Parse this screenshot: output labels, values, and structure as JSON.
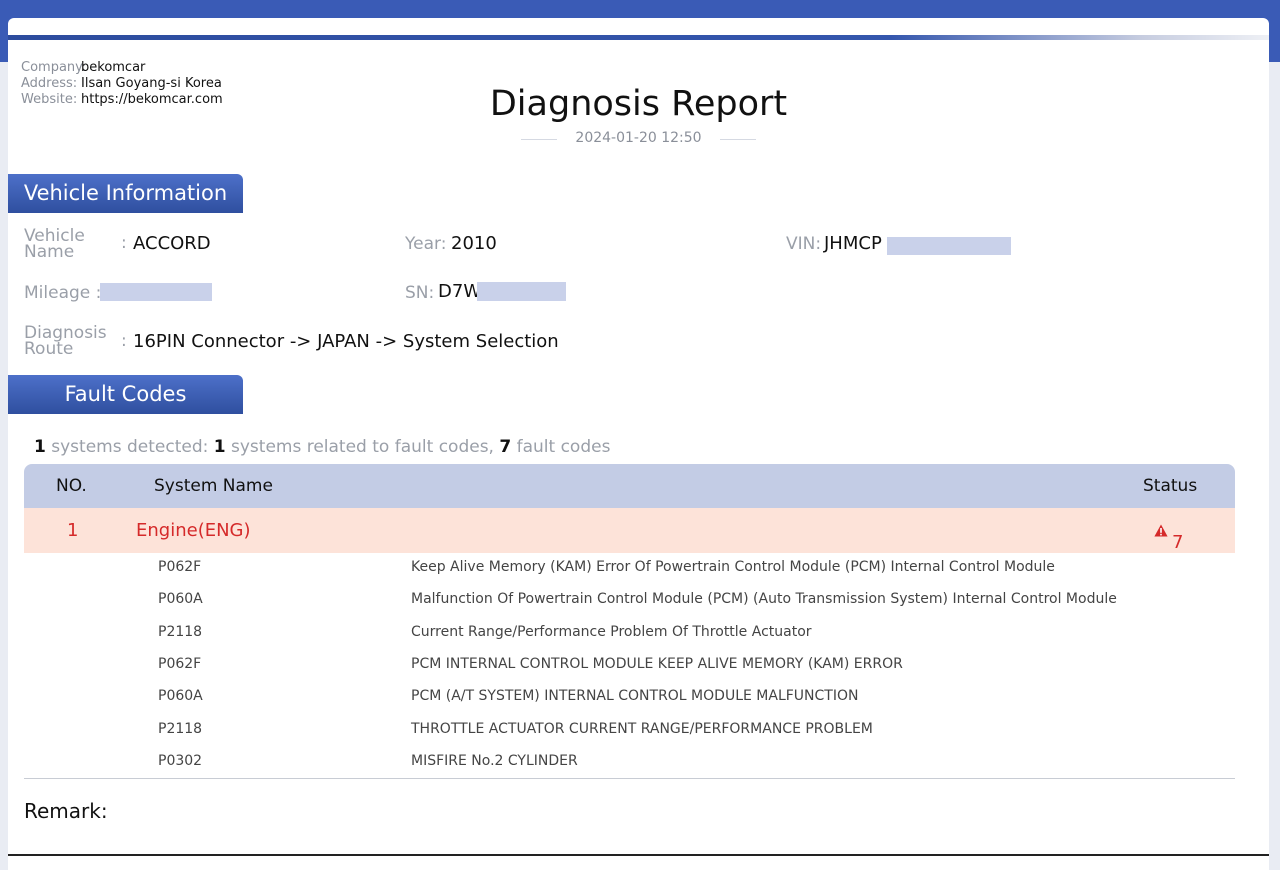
{
  "header": {
    "company_label": "Company:",
    "company": "bekomcar",
    "address_label": "Address:",
    "address": "Ilsan Goyang-si Korea",
    "website_label": "Website:",
    "website": "https://bekomcar.com",
    "title": "Diagnosis Report",
    "datetime": "2024-01-20 12:50"
  },
  "vehicle_section": {
    "title": "Vehicle Information",
    "name_label_line1": "Vehicle",
    "name_label_line2": "Name",
    "name_sep": ":",
    "name": "ACCORD",
    "year_label": "Year:",
    "year": "2010",
    "vin_label": "VIN:",
    "vin": "JHMCP",
    "mileage_label": "Mileage :",
    "sn_label": "SN:",
    "sn": "D7W",
    "route_label_line1": "Diagnosis",
    "route_label_line2": "Route",
    "route_sep": ":",
    "route": "16PIN Connector -> JAPAN -> System Selection"
  },
  "fault_section": {
    "title": "Fault Codes",
    "summary": {
      "systems_detected": "1",
      "systems_detected_text": "systems detected:",
      "systems_related": "1",
      "systems_related_text": "systems related to fault codes,",
      "fault_count": "7",
      "fault_count_text": "fault codes"
    },
    "columns": {
      "no": "NO.",
      "system": "System Name",
      "status": "Status"
    },
    "system": {
      "no": "1",
      "name": "Engine(ENG)",
      "status": "7"
    },
    "codes": [
      {
        "code": "P062F",
        "desc": "Keep Alive Memory (KAM) Error Of Powertrain Control Module (PCM) Internal Control Module"
      },
      {
        "code": "P060A",
        "desc": "Malfunction Of Powertrain Control Module (PCM) (Auto Transmission System) Internal Control Module"
      },
      {
        "code": "P2118",
        "desc": "Current Range/Performance Problem Of Throttle Actuator"
      },
      {
        "code": "P062F",
        "desc": "PCM INTERNAL CONTROL MODULE KEEP ALIVE MEMORY (KAM) ERROR"
      },
      {
        "code": "P060A",
        "desc": "PCM (A/T SYSTEM) INTERNAL CONTROL MODULE MALFUNCTION"
      },
      {
        "code": "P2118",
        "desc": "THROTTLE ACTUATOR CURRENT RANGE/PERFORMANCE PROBLEM"
      },
      {
        "code": "P0302",
        "desc": "MISFIRE No.2 CYLINDER"
      }
    ]
  },
  "remark_label": "Remark:",
  "colors": {
    "header_blue": "#3a5bb6",
    "fault_red": "#d52a2a",
    "table_header": "#c3cce5",
    "fault_row_bg": "#fde3d9"
  }
}
